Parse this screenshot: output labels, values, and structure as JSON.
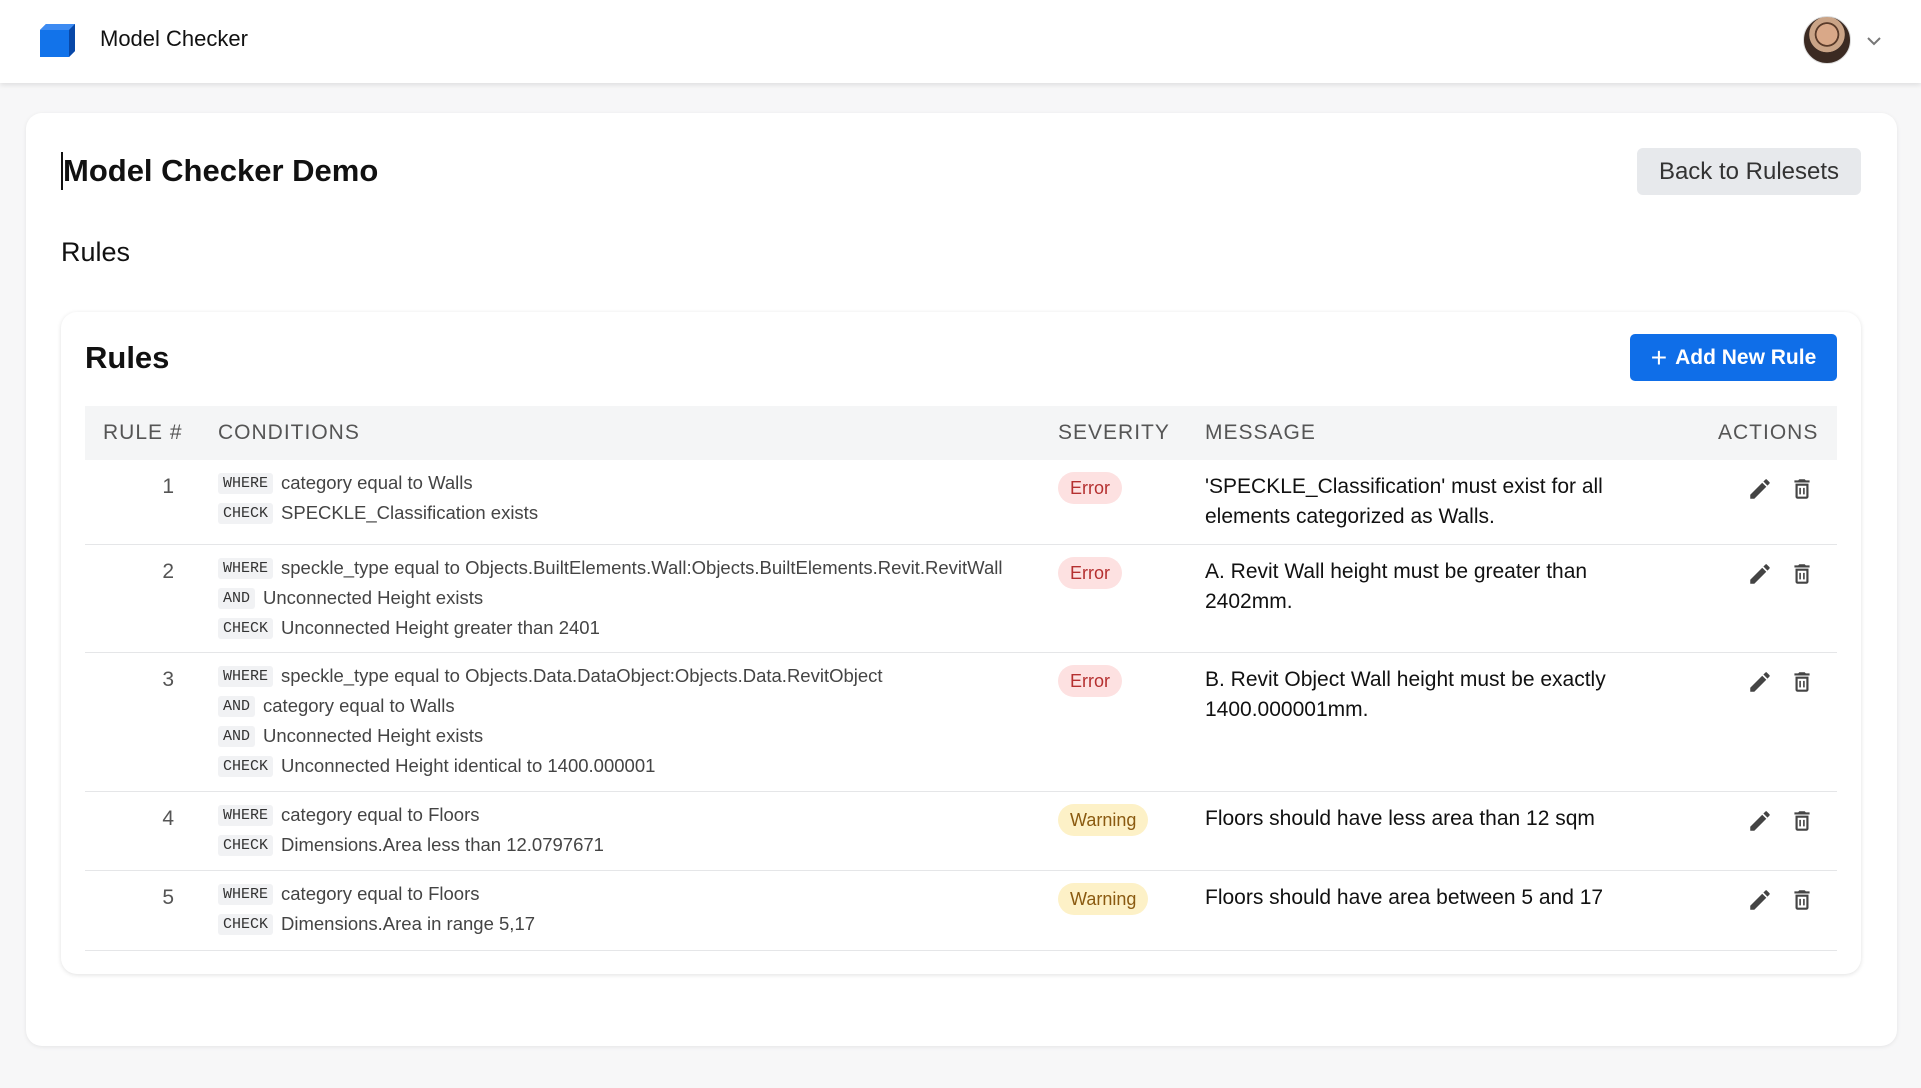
{
  "header": {
    "app_title": "Model Checker",
    "logo_icon": "cube-logo-icon",
    "avatar": "user-avatar",
    "menu_icon": "chevron-down-icon"
  },
  "page": {
    "title": "Model Checker Demo",
    "back_label": "Back to Rulesets",
    "section_heading": "Rules"
  },
  "rules_card": {
    "heading": "Rules",
    "add_label": "Add New Rule",
    "columns": [
      "RULE #",
      "CONDITIONS",
      "SEVERITY",
      "MESSAGE",
      "ACTIONS"
    ],
    "rows": [
      {
        "num": "1",
        "conditions": [
          {
            "kw": "WHERE",
            "text": "category equal to Walls"
          },
          {
            "kw": "CHECK",
            "text": "SPECKLE_Classification exists"
          }
        ],
        "severity": "Error",
        "message": "'SPECKLE_Classification' must exist for all elements categorized as Walls."
      },
      {
        "num": "2",
        "conditions": [
          {
            "kw": "WHERE",
            "text": "speckle_type equal to Objects.BuiltElements.Wall:Objects.BuiltElements.Revit.RevitWall"
          },
          {
            "kw": "AND",
            "text": "Unconnected Height exists"
          },
          {
            "kw": "CHECK",
            "text": "Unconnected Height greater than 2401"
          }
        ],
        "severity": "Error",
        "message": "A. Revit Wall height must be greater than 2402mm."
      },
      {
        "num": "3",
        "conditions": [
          {
            "kw": "WHERE",
            "text": "speckle_type equal to Objects.Data.DataObject:Objects.Data.RevitObject"
          },
          {
            "kw": "AND",
            "text": "category equal to Walls"
          },
          {
            "kw": "AND",
            "text": "Unconnected Height exists"
          },
          {
            "kw": "CHECK",
            "text": "Unconnected Height identical to 1400.000001"
          }
        ],
        "severity": "Error",
        "message": "B. Revit Object Wall height must be exactly 1400.000001mm."
      },
      {
        "num": "4",
        "conditions": [
          {
            "kw": "WHERE",
            "text": "category equal to Floors"
          },
          {
            "kw": "CHECK",
            "text": "Dimensions.Area less than 12.0797671"
          }
        ],
        "severity": "Warning",
        "message": "Floors should have less area than 12 sqm"
      },
      {
        "num": "5",
        "conditions": [
          {
            "kw": "WHERE",
            "text": "category equal to Floors"
          },
          {
            "kw": "CHECK",
            "text": "Dimensions.Area in range 5,17"
          }
        ],
        "severity": "Warning",
        "message": "Floors should have area between 5 and 17"
      }
    ],
    "action_icons": [
      "pencil-icon",
      "trash-icon"
    ]
  },
  "colors": {
    "accent": "#0f6ee8",
    "error_bg": "#fde1e1",
    "error_text": "#b53030",
    "warning_bg": "#fdf1c7",
    "warning_text": "#8a5a10"
  }
}
